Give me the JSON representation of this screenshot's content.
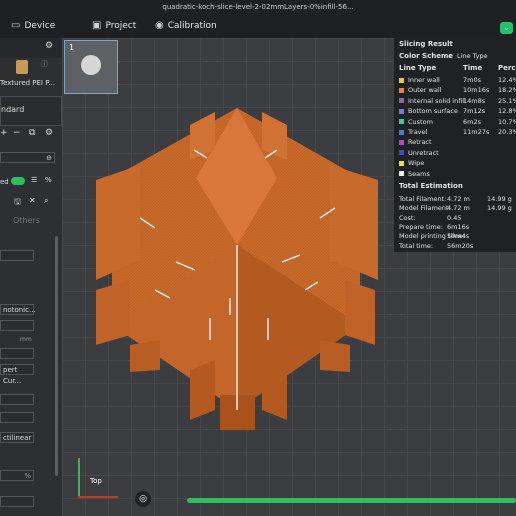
{
  "window": {
    "title": "quadratic-koch-slice-level-2-02mmLayers-0%infill-56..."
  },
  "menu": {
    "device": "Device",
    "project": "Project",
    "calibration": "Calibration"
  },
  "sidebar": {
    "plate_label": "Textured PEI P...",
    "process_name": "ndard",
    "enable_label": "ed",
    "others_tab": "Others",
    "fields": [
      "notonic...",
      "pert Cur...",
      "ctilinear"
    ],
    "unit_mm": "mm",
    "unit_pct": "%"
  },
  "plate_number": "1",
  "legend": {
    "title": "Slicing Result",
    "color_scheme_label": "Color Scheme",
    "color_scheme_value": "Line Type",
    "headers": [
      "Line Type",
      "Time",
      "Percen"
    ],
    "rows": [
      {
        "name": "Inner wall",
        "time": "7m0s",
        "pct": "12.4%",
        "color": "#f0c648"
      },
      {
        "name": "Outer wall",
        "time": "10m16s",
        "pct": "18.2%",
        "color": "#f0833a"
      },
      {
        "name": "Internal solid infill",
        "time": "14m8s",
        "pct": "25.1%",
        "color": "#9b59b6"
      },
      {
        "name": "Bottom surface",
        "time": "7m12s",
        "pct": "12.8%",
        "color": "#6a7de6"
      },
      {
        "name": "Custom",
        "time": "6m2s",
        "pct": "10.7%",
        "color": "#3ec9a0"
      },
      {
        "name": "Travel",
        "time": "11m27s",
        "pct": "20.3%",
        "color": "#3b82d6"
      },
      {
        "name": "Retract",
        "time": "",
        "pct": "",
        "color": "#c13ad6"
      },
      {
        "name": "Unretract",
        "time": "",
        "pct": "",
        "color": "#3552c8"
      },
      {
        "name": "Wipe",
        "time": "",
        "pct": "",
        "color": "#e9e43a"
      },
      {
        "name": "Seams",
        "time": "",
        "pct": "",
        "color": "#eeeeee"
      }
    ],
    "estimation_title": "Total Estimation",
    "estimation": [
      {
        "label": "Total Filament:",
        "v1": "4.72 m",
        "v2": "14.99 g"
      },
      {
        "label": "Model Filament:",
        "v1": "4.72 m",
        "v2": "14.99 g"
      },
      {
        "label": "Cost:",
        "v1": "0.45",
        "v2": ""
      },
      {
        "label": "Prepare time:",
        "v1": "6m16s",
        "v2": ""
      },
      {
        "label": "Model printing time:",
        "v1": "50m4s",
        "v2": ""
      },
      {
        "label": "Total time:",
        "v1": "56m20s",
        "v2": ""
      }
    ]
  },
  "view": {
    "top_label": "Top"
  },
  "progress": 1.0
}
